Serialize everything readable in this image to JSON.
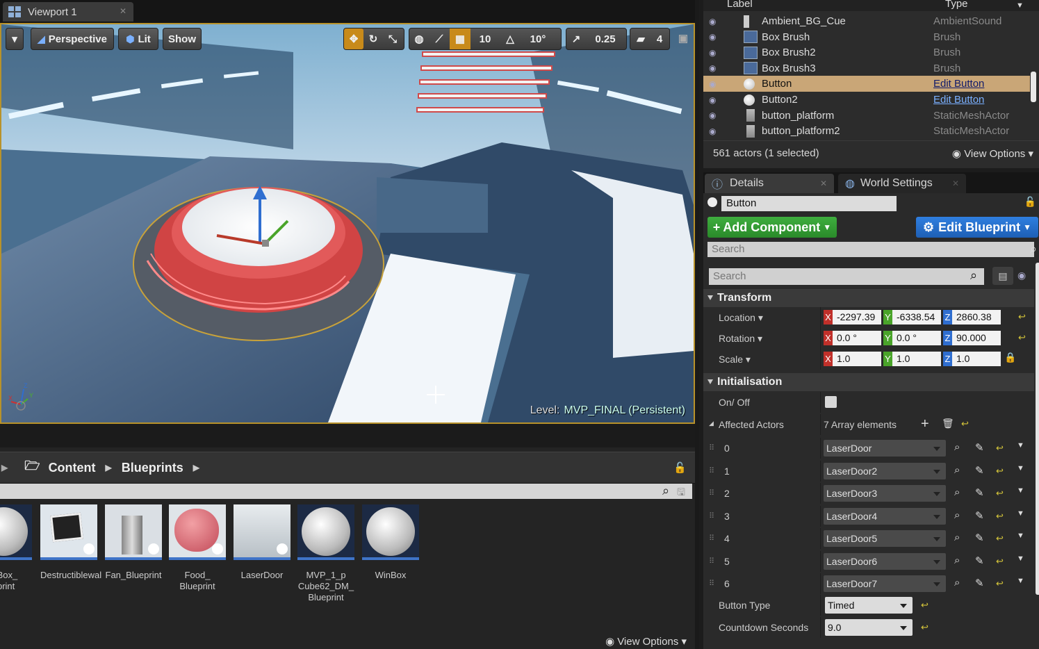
{
  "viewport_tab": {
    "title": "Viewport 1"
  },
  "viewport": {
    "perspective": "Perspective",
    "lit": "Lit",
    "show": "Show",
    "grid_snap": "10",
    "rot_snap": "10°",
    "scale_snap": "0.25",
    "cam_speed": "4",
    "level_prefix": "Level:",
    "level_name": "MVP_FINAL (Persistent)"
  },
  "content_browser": {
    "crumbs": [
      "Content",
      "Blueprints"
    ],
    "assets": [
      {
        "name": "thBox_\neprint",
        "thumb": "sphere"
      },
      {
        "name": "Destructiblewal",
        "thumb": "device"
      },
      {
        "name": "Fan_Blueprint",
        "thumb": "fan"
      },
      {
        "name": "Food_\nBlueprint",
        "thumb": "brain"
      },
      {
        "name": "LaserDoor",
        "thumb": "floor"
      },
      {
        "name": "MVP_1_p\nCube62_DM_\nBlueprint",
        "thumb": "sphere"
      },
      {
        "name": "WinBox",
        "thumb": "sphere"
      }
    ],
    "view_options": "View Options"
  },
  "outliner": {
    "col_label": "Label",
    "col_type": "Type",
    "rows": [
      {
        "label": "Ambient_BG_Cue",
        "type": "AmbientSound",
        "icon": "sound-icon",
        "link": false,
        "selected": false
      },
      {
        "label": "Box Brush",
        "type": "Brush",
        "icon": "brush-icon",
        "link": false,
        "selected": false
      },
      {
        "label": "Box Brush2",
        "type": "Brush",
        "icon": "brush-icon",
        "link": false,
        "selected": false
      },
      {
        "label": "Box Brush3",
        "type": "Brush",
        "icon": "brush-icon",
        "link": false,
        "selected": false
      },
      {
        "label": "Button",
        "type": "Edit Button",
        "icon": "actor-icon",
        "link": true,
        "selected": true
      },
      {
        "label": "Button2",
        "type": "Edit Button",
        "icon": "actor-icon",
        "link": true,
        "selected": false
      },
      {
        "label": "button_platform",
        "type": "StaticMeshActor",
        "icon": "mesh-icon",
        "link": false,
        "selected": false
      },
      {
        "label": "button_platform2",
        "type": "StaticMeshActor",
        "icon": "mesh-icon",
        "link": false,
        "selected": false
      }
    ],
    "status": "561 actors (1 selected)",
    "view_options": "View Options"
  },
  "details": {
    "tab_details": "Details",
    "tab_world": "World Settings",
    "actor_name": "Button",
    "add_component": "Add Component",
    "edit_blueprint": "Edit Blueprint",
    "search_placeholder": "Search",
    "filter_placeholder": "Search",
    "transform": {
      "title": "Transform",
      "location_label": "Location",
      "rotation_label": "Rotation",
      "scale_label": "Scale",
      "location": [
        "-2297.39",
        "-6338.54",
        "2860.38"
      ],
      "rotation": [
        "0.0 °",
        "0.0 °",
        "90.000"
      ],
      "scale": [
        "1.0",
        "1.0",
        "1.0"
      ]
    },
    "initialisation": {
      "title": "Initialisation",
      "onoff_label": "On/ Off",
      "affected_label": "Affected Actors",
      "affected_count": "7 Array elements",
      "elements": [
        {
          "index": "0",
          "value": "LaserDoor"
        },
        {
          "index": "1",
          "value": "LaserDoor2"
        },
        {
          "index": "2",
          "value": "LaserDoor3"
        },
        {
          "index": "3",
          "value": "LaserDoor4"
        },
        {
          "index": "4",
          "value": "LaserDoor5"
        },
        {
          "index": "5",
          "value": "LaserDoor6"
        },
        {
          "index": "6",
          "value": "LaserDoor7"
        }
      ],
      "button_type_label": "Button Type",
      "button_type": "Timed",
      "countdown_label": "Countdown Seconds",
      "countdown": "9.0"
    }
  },
  "colors": {
    "accent": "#c88a1a",
    "selection": "#c9a677",
    "x_axis": "#c0302a",
    "y_axis": "#4aa42a",
    "z_axis": "#2f6ed0"
  }
}
